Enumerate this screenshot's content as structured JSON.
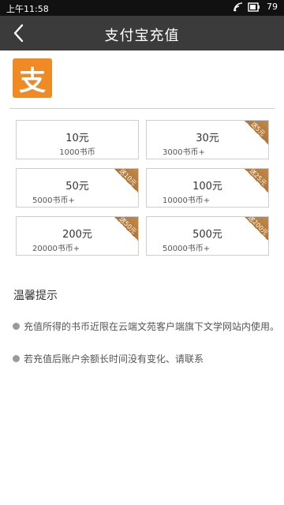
{
  "status": {
    "time": "上午11:58",
    "battery": "79",
    "icons": [
      "wifi-icon",
      "battery-icon"
    ]
  },
  "nav": {
    "title": "支付宝充值",
    "back_icon": "back-chevron-icon"
  },
  "logo": {
    "glyph": "支",
    "color": "#f08a24"
  },
  "options": [
    {
      "price": "10元",
      "coins": "1000书币",
      "badge": ""
    },
    {
      "price": "30元",
      "coins": "3000书币+",
      "badge": "送5元"
    },
    {
      "price": "50元",
      "coins": "5000书币+",
      "badge": "送10元"
    },
    {
      "price": "100元",
      "coins": "10000书币+",
      "badge": "送25元"
    },
    {
      "price": "200元",
      "coins": "20000书币+",
      "badge": "送50元"
    },
    {
      "price": "500元",
      "coins": "50000书币+",
      "badge": "送200元"
    }
  ],
  "tips": {
    "title": "温馨提示",
    "items": [
      "充值所得的书币近限在云端文苑客户端旗下文学网站内使用。",
      "若充值后账户余额长时间没有变化、请联系"
    ]
  },
  "colors": {
    "nav_bg": "#3b3b3b",
    "status_bg": "#111111",
    "ribbon": "#b07636",
    "accent": "#f08a24"
  }
}
